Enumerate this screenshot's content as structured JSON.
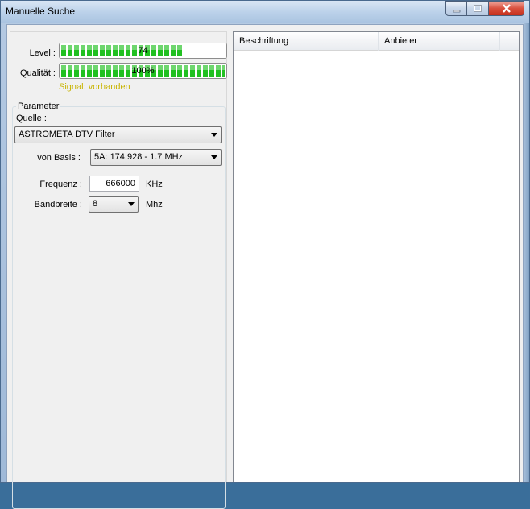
{
  "window": {
    "title": "Manuelle Suche",
    "buttons": {
      "minimize": "minimize-icon",
      "maximize": "maximize-icon",
      "close": "close-icon"
    }
  },
  "signal": {
    "level_label": "Level :",
    "level_value": "74",
    "level_fraction": 0.74,
    "quality_label": "Qualität :",
    "quality_value": "100%",
    "quality_fraction": 1.0,
    "status_text": "Signal: vorhanden",
    "status_color": "#c8b400"
  },
  "parameter": {
    "group_title": "Parameter",
    "source_label": "Quelle :",
    "source_value": "ASTROMETA DTV Filter",
    "basis_label": "von Basis :",
    "basis_value": "5A: 174.928 - 1.7 MHz",
    "frequency_label": "Frequenz :",
    "frequency_value": "666000",
    "frequency_unit": "KHz",
    "bandwidth_label": "Bandbreite :",
    "bandwidth_value": "8",
    "bandwidth_unit": "Mhz"
  },
  "list": {
    "columns": [
      "Beschriftung",
      "Anbieter"
    ],
    "rows": []
  },
  "colors": {
    "progress_green": "#21c021",
    "close_red": "#c5301c"
  }
}
